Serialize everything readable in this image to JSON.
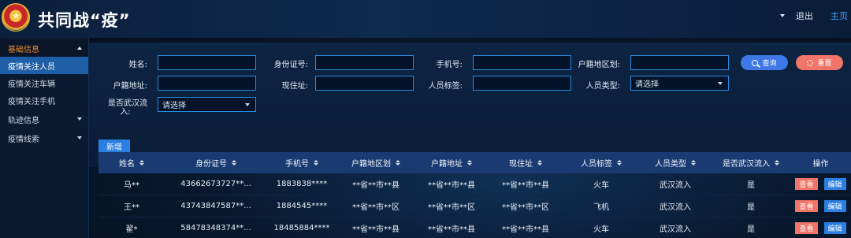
{
  "header": {
    "title": "共同战“疫”",
    "logout": "退出",
    "home": "主页"
  },
  "sidebar": {
    "groups": [
      {
        "label": "基础信息",
        "items": [
          "疫情关注人员",
          "疫情关注车辆",
          "疫情关注手机"
        ]
      },
      {
        "label": "轨迹信息"
      },
      {
        "label": "疫情线索"
      }
    ]
  },
  "filters": {
    "name_label": "姓名:",
    "id_label": "身份证号:",
    "phone_label": "手机号:",
    "region_label": "户籍地区划:",
    "address_label": "户籍地址:",
    "current_label": "现住址:",
    "tag_label": "人员标签:",
    "type_label": "人员类型:",
    "type_value": "请选择",
    "wuhan_label_1": "是否武汉流",
    "wuhan_label_2": "入:",
    "wuhan_value": "请选择",
    "query_button": "查询",
    "reset_button": "重置",
    "add_button": "新增"
  },
  "table": {
    "columns": [
      "姓名",
      "身份证号",
      "手机号",
      "户籍地区划",
      "户籍地址",
      "现住址",
      "人员标签",
      "人员类型",
      "是否武汉流入",
      "操作"
    ],
    "rows": [
      [
        "马**",
        "43662673727**...",
        "1883838****",
        "**省**市**县",
        "**省**市**县",
        "**省**市**县",
        "火车",
        "武汉流入",
        "是"
      ],
      [
        "王**",
        "43743847587**...",
        "1884545****",
        "**省**市**区",
        "**省**市**区",
        "**省**市**区",
        "飞机",
        "武汉流入",
        "是"
      ],
      [
        "翟*",
        "58478348374**...",
        "18485884****",
        "**省**市**县",
        "**省**市**县",
        "**省**市**县",
        "火车",
        "武汉流入",
        "是"
      ]
    ],
    "view_label": "查看",
    "edit_label": "编辑"
  }
}
